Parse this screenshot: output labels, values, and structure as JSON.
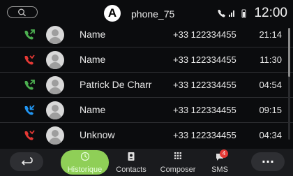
{
  "header": {
    "callout_label": "A",
    "device_name": "phone_75",
    "clock": "12:00"
  },
  "calls": [
    {
      "name": "Name",
      "number": "+33 122334455",
      "time": "21:14",
      "call_type": "outgoing",
      "color": "#4caf50"
    },
    {
      "name": "Name",
      "number": "+33 122334455",
      "time": "11:30",
      "call_type": "missed",
      "color": "#e53935"
    },
    {
      "name": "Patrick De Charr",
      "number": "+33 122334455",
      "time": "04:54",
      "call_type": "outgoing",
      "color": "#4caf50"
    },
    {
      "name": "Name",
      "number": "+33 122334455",
      "time": "09:15",
      "call_type": "incoming",
      "color": "#2196f3"
    },
    {
      "name": "Unknow",
      "number": "+33 122334455",
      "time": "04:34",
      "call_type": "missed",
      "color": "#e53935"
    }
  ],
  "bottom_nav": {
    "tabs": [
      {
        "label": "Historique",
        "icon": "clock-icon",
        "active": true
      },
      {
        "label": "Contacts",
        "icon": "contacts-icon",
        "active": false
      },
      {
        "label": "Composer",
        "icon": "keypad-icon",
        "active": false
      },
      {
        "label": "SMS",
        "icon": "sms-icon",
        "active": false,
        "badge": "4"
      }
    ],
    "more_label": "..."
  },
  "colors": {
    "accent": "#8fcf57",
    "background": "#0b0c0e",
    "missed": "#e53935",
    "outgoing": "#4caf50",
    "incoming": "#2196f3"
  }
}
